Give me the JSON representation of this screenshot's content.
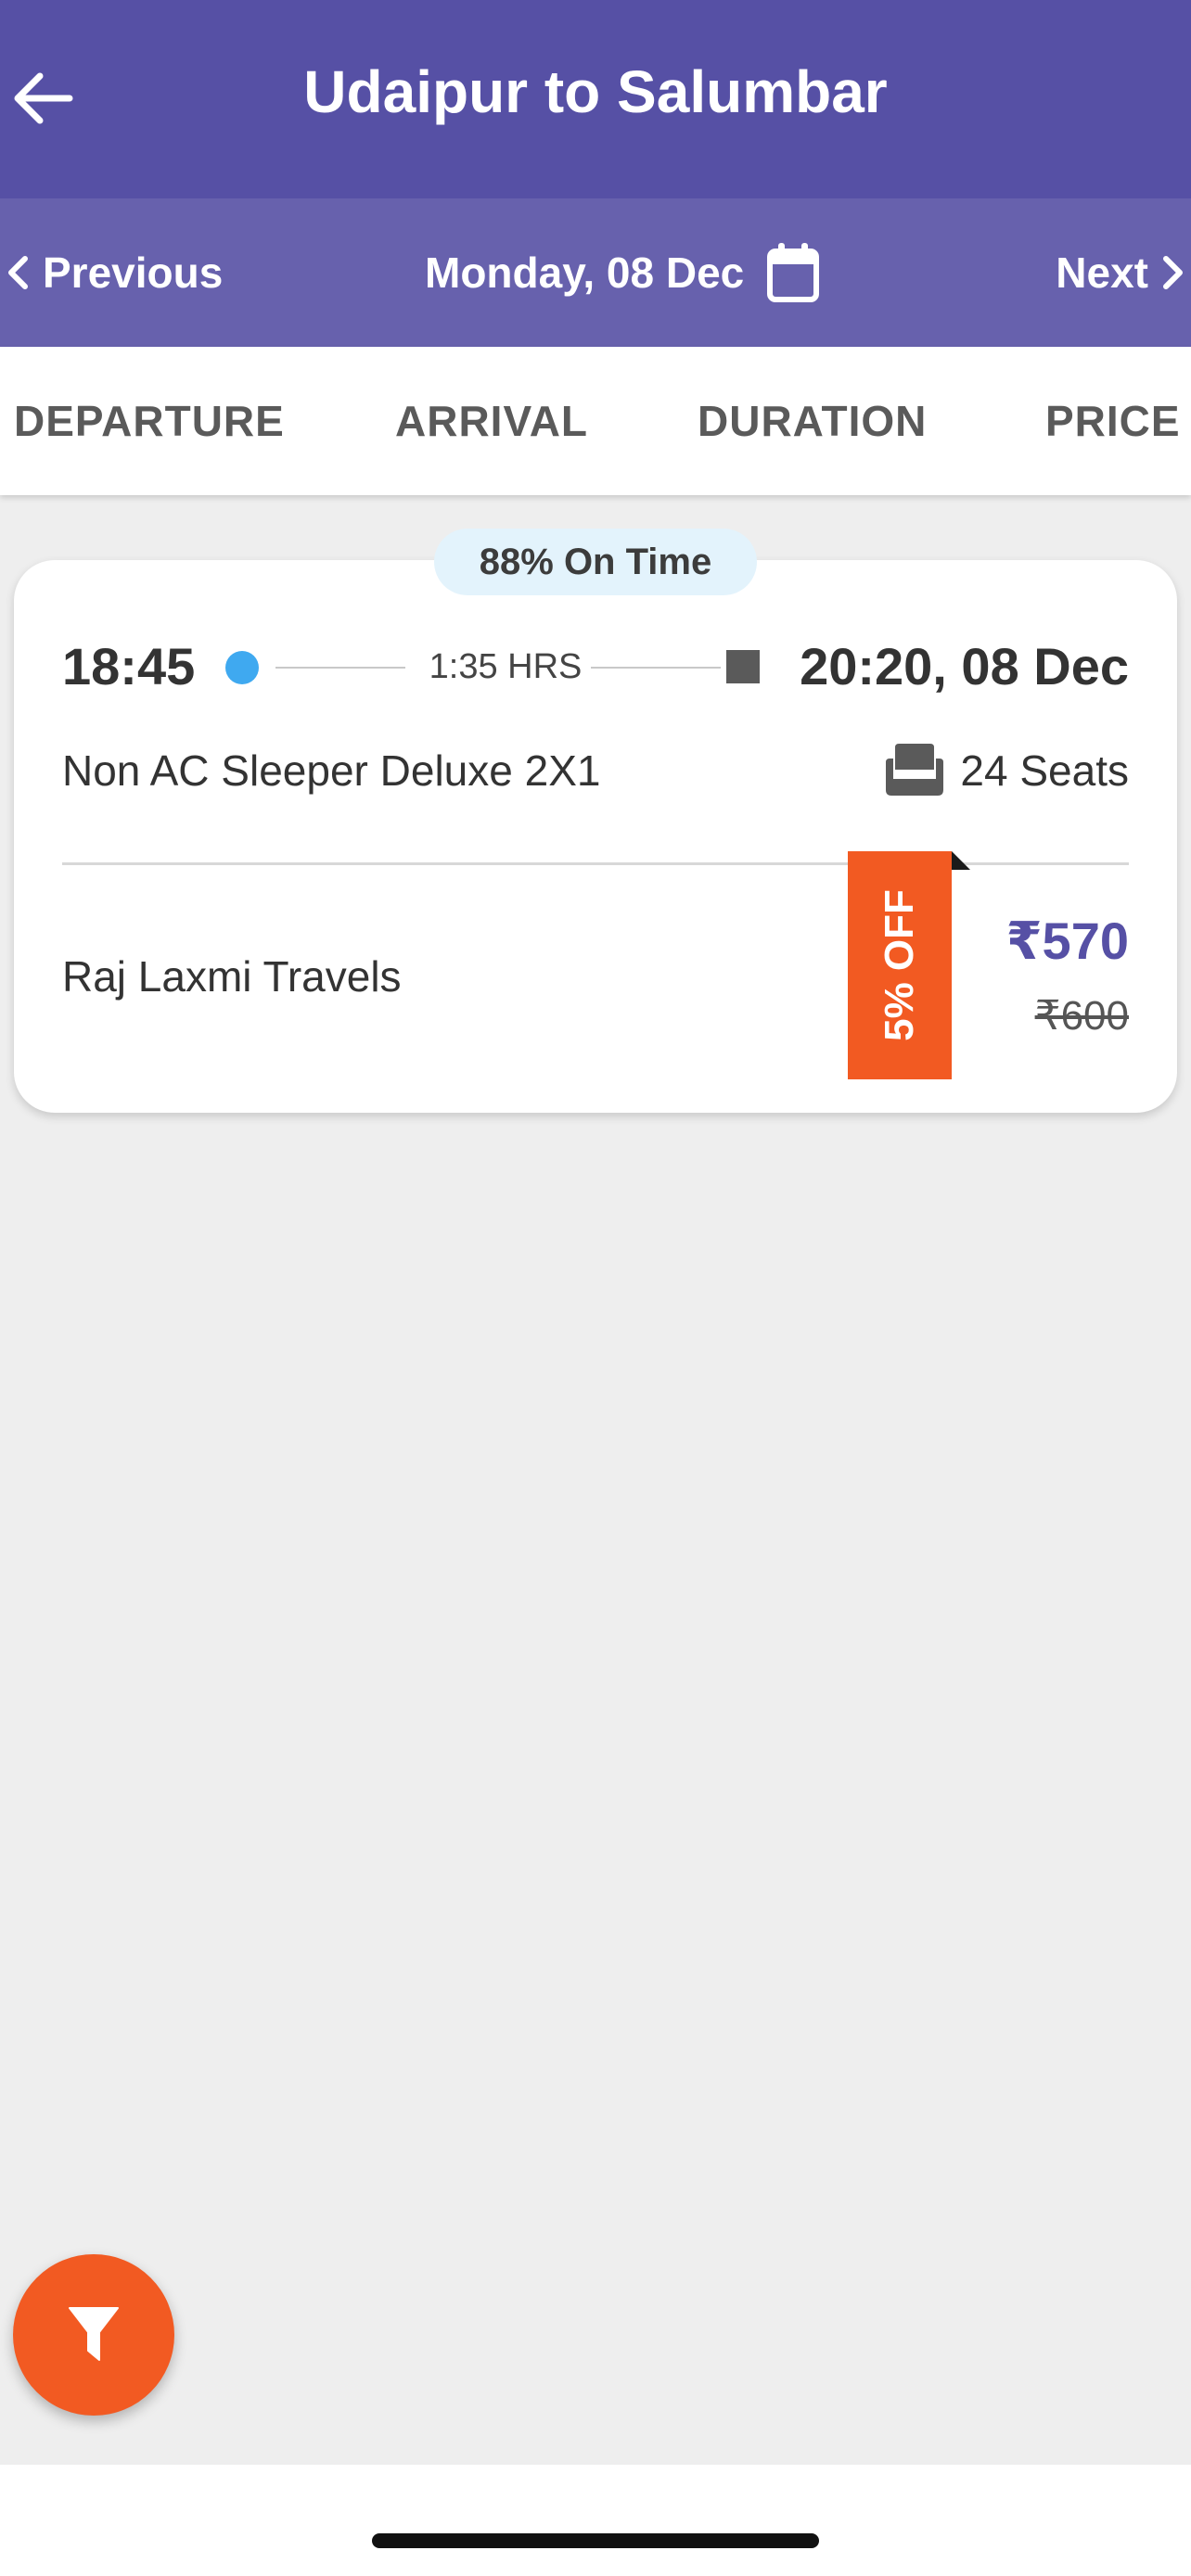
{
  "header": {
    "title": "Udaipur to Salumbar",
    "back_icon": "arrow-left-icon",
    "background_color": "#5650a5"
  },
  "date_nav": {
    "previous_label": "Previous",
    "date_label": "Monday, 08 Dec",
    "next_label": "Next",
    "calendar_icon": "calendar-icon",
    "background_color": "#6761ad"
  },
  "sort_tabs": [
    {
      "label": "DEPARTURE"
    },
    {
      "label": "ARRIVAL"
    },
    {
      "label": "DURATION"
    },
    {
      "label": "PRICE"
    }
  ],
  "results": [
    {
      "on_time": "88% On Time",
      "departure_time": "18:45",
      "duration": "1:35 HRS",
      "arrival": "20:20, 08 Dec",
      "bus_type": "Non AC Sleeper Deluxe 2X1",
      "seats": "24 Seats",
      "operator": "Raj Laxmi Travels",
      "discount": "5% OFF",
      "price": "₹570",
      "original_price": "₹600"
    }
  ],
  "colors": {
    "accent": "#5650a5",
    "discount": "#f25a22",
    "departure_dot": "#3fa9f0",
    "on_time_badge": "#e3f3fc"
  },
  "fab": {
    "icon": "filter-icon",
    "color": "#f25a22"
  }
}
